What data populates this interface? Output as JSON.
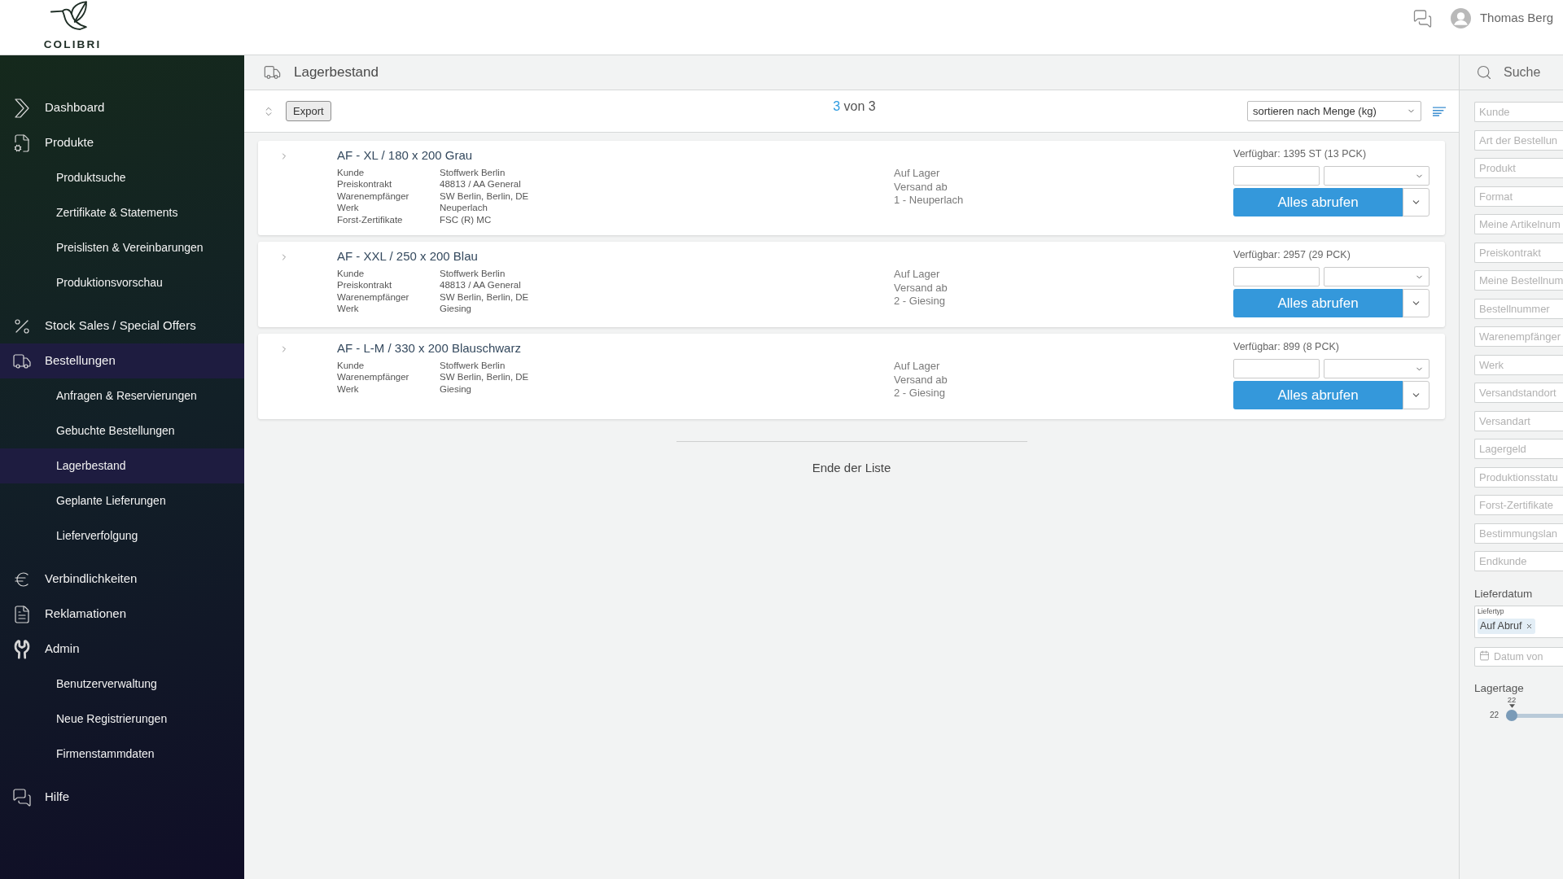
{
  "header": {
    "logo_text": "COLIBRI",
    "user_name": "Thomas Berg"
  },
  "sidebar": {
    "items": [
      {
        "label": "Dashboard",
        "selected": false
      },
      {
        "label": "Produkte",
        "selected": false,
        "children": [
          {
            "label": "Produktsuche",
            "selected": false
          },
          {
            "label": "Zertifikate & Statements",
            "selected": false
          },
          {
            "label": "Preislisten & Vereinbarungen",
            "selected": false
          },
          {
            "label": "Produktionsvorschau",
            "selected": false
          }
        ]
      },
      {
        "label": "Stock Sales / Special Offers",
        "selected": false
      },
      {
        "label": "Bestellungen",
        "selected": true,
        "children": [
          {
            "label": "Anfragen & Reservierungen",
            "selected": false
          },
          {
            "label": "Gebuchte Bestellungen",
            "selected": false
          },
          {
            "label": "Lagerbestand",
            "selected": true
          },
          {
            "label": "Geplante Lieferungen",
            "selected": false
          },
          {
            "label": "Lieferverfolgung",
            "selected": false
          }
        ]
      },
      {
        "label": "Verbindlichkeiten",
        "selected": false
      },
      {
        "label": "Reklamationen",
        "selected": false
      },
      {
        "label": "Admin",
        "selected": false,
        "children": [
          {
            "label": "Benutzerverwaltung",
            "selected": false
          },
          {
            "label": "Neue Registrierungen",
            "selected": false
          },
          {
            "label": "Firmenstammdaten",
            "selected": false
          }
        ]
      },
      {
        "label": "Hilfe",
        "selected": false
      }
    ]
  },
  "page_header": {
    "title": "Lagerbestand"
  },
  "toolbar": {
    "export_label": "Export",
    "result_count": {
      "current": "3",
      "rest": "von 3"
    },
    "sort_select": {
      "value": "sortieren nach Menge (kg)"
    }
  },
  "items": [
    {
      "title": "AF - XL / 180 x 200 Grau",
      "details": [
        {
          "label": "Kunde",
          "value": "Stoffwerk Berlin"
        },
        {
          "label": "Preiskontrakt",
          "value": "48813 / AA General"
        },
        {
          "label": "Warenempfänger",
          "value": "SW Berlin, Berlin, DE"
        },
        {
          "label": "Werk",
          "value": "Neuperlach"
        },
        {
          "label": "Forst-Zertifikate",
          "value": "FSC (R) MC"
        }
      ],
      "status": [
        "Auf Lager",
        "Versand ab",
        "1 - Neuperlach"
      ],
      "available": "Verfügbar: 1395 ST (13 PCK)",
      "action_label": "Alles abrufen"
    },
    {
      "title": "AF - XXL / 250 x 200 Blau",
      "details": [
        {
          "label": "Kunde",
          "value": "Stoffwerk Berlin"
        },
        {
          "label": "Preiskontrakt",
          "value": "48813 / AA General"
        },
        {
          "label": "Warenempfänger",
          "value": "SW Berlin, Berlin, DE"
        },
        {
          "label": "Werk",
          "value": "Giesing"
        }
      ],
      "status": [
        "Auf Lager",
        "Versand ab",
        "2 - Giesing"
      ],
      "available": "Verfügbar: 2957 (29 PCK)",
      "action_label": "Alles abrufen"
    },
    {
      "title": "AF - L-M / 330 x 200 Blauschwarz",
      "details": [
        {
          "label": "Kunde",
          "value": "Stoffwerk Berlin"
        },
        {
          "label": "Warenempfänger",
          "value": "SW Berlin, Berlin, DE"
        },
        {
          "label": "Werk",
          "value": "Giesing"
        }
      ],
      "status": [
        "Auf Lager",
        "Versand ab",
        "2 - Giesing"
      ],
      "available": "Verfügbar: 899 (8 PCK)",
      "action_label": "Alles abrufen"
    }
  ],
  "end_of_list": "Ende der Liste",
  "filter_panel": {
    "title": "Suche",
    "fields": [
      {
        "placeholder": "Kunde"
      },
      {
        "placeholder": "Art der Bestellun"
      },
      {
        "placeholder": "Produkt"
      },
      {
        "placeholder": "Format"
      },
      {
        "placeholder": "Meine Artikelnum"
      },
      {
        "placeholder": "Preiskontrakt"
      },
      {
        "placeholder": "Meine Bestellnum"
      },
      {
        "placeholder": "Bestellnummer"
      },
      {
        "placeholder": "Warenempfänger"
      },
      {
        "placeholder": "Werk"
      },
      {
        "placeholder": "Versandstandort"
      },
      {
        "placeholder": "Versandart"
      },
      {
        "placeholder": "Lagergeld"
      },
      {
        "placeholder": "Produktionsstatu"
      },
      {
        "placeholder": "Forst-Zertifikate"
      },
      {
        "placeholder": "Bestimmungslan"
      },
      {
        "placeholder": "Endkunde"
      }
    ],
    "delivery_date": {
      "label": "Lieferdatum",
      "type_field": {
        "label": "Liefertyp",
        "chips": [
          "Auf Abruf"
        ]
      },
      "date_from": {
        "placeholder": "Datum von"
      }
    },
    "storage_days": {
      "label": "Lagertage",
      "value_label": "22",
      "min_label": "22",
      "level": 0
    }
  }
}
